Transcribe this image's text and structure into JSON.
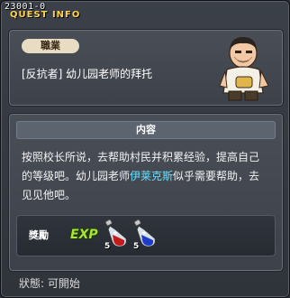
{
  "window": {
    "id": "23001-0",
    "title": "QUEST INFO"
  },
  "job": {
    "label": "職業",
    "quest_name": "[反抗者] 幼儿园老师的拜托"
  },
  "content": {
    "header": "内容",
    "line1": "按照校长所说，去帮助村民并积累经验，提高自己",
    "line2_before": "的等级吧。幼儿园老师",
    "npc_name": "伊莱克斯",
    "line2_after": "似乎需要帮助，去",
    "line3": "见见他吧。"
  },
  "reward": {
    "label": "獎勵",
    "exp_label": "EXP",
    "items": [
      {
        "icon": "red-potion-icon",
        "qty": "5"
      },
      {
        "icon": "blue-potion-icon",
        "qty": "5"
      }
    ]
  },
  "status": {
    "text": "狀態:  可開始"
  },
  "colors": {
    "accent": "#ffd24a",
    "npc": "#66e0ff",
    "exp": "#a8e23a"
  }
}
